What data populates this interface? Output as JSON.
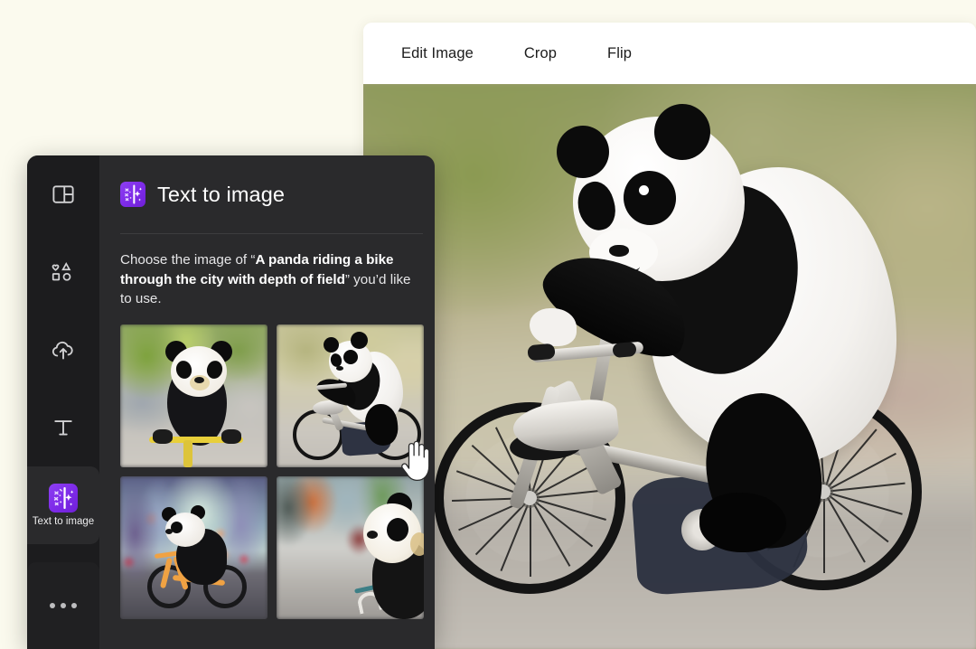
{
  "app": {
    "canvas_background": "#fbfaee",
    "accent_purple": "#7d2ae8",
    "panel_background": "#2a2a2c",
    "rail_background": "#1c1c1e"
  },
  "image_toolbar": {
    "buttons": [
      {
        "label": "Edit Image",
        "name": "edit-image-button"
      },
      {
        "label": "Crop",
        "name": "crop-button"
      },
      {
        "label": "Flip",
        "name": "flip-button"
      }
    ]
  },
  "hero": {
    "alt": "A panda riding a bike through the city with depth of field"
  },
  "rail": {
    "items": [
      {
        "label": "",
        "icon": "layout-icon",
        "active": false
      },
      {
        "label": "",
        "icon": "elements-shapes-icon",
        "active": false
      },
      {
        "label": "",
        "icon": "cloud-upload-icon",
        "active": false
      },
      {
        "label": "",
        "icon": "text-t-icon",
        "active": false
      },
      {
        "label": "Text to image",
        "icon": "text-to-image-sparkle-icon",
        "active": true
      }
    ],
    "more_label": "•••"
  },
  "panel": {
    "title": "Text to image",
    "badge_icon": "text-to-image-sparkle-icon",
    "instruction": {
      "prefix": "Choose the image of “",
      "prompt": "A panda riding a bike through the city with depth of field",
      "suffix": "” you’d like to use."
    }
  },
  "results": {
    "thumbnails": [
      {
        "name": "result-thumbnail-1",
        "alt": "Panda riding a yellow bike on a green street"
      },
      {
        "name": "result-thumbnail-2",
        "alt": "Panda riding a silver bike in a park, hovered"
      },
      {
        "name": "result-thumbnail-3",
        "alt": "Panda riding an orange bike in a teal city"
      },
      {
        "name": "result-thumbnail-4",
        "alt": "Panda close-up riding a bike on a grey street"
      }
    ]
  },
  "cursor": {
    "type": "hand-pointer-cursor"
  }
}
